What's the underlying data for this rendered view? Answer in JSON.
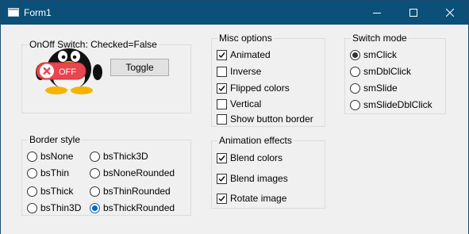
{
  "window": {
    "title": "Form1"
  },
  "onoff": {
    "caption": "OnOff Switch: Checked=False",
    "switch_text": "OFF",
    "toggle_label": "Toggle"
  },
  "border_style": {
    "caption": "Border style",
    "options": [
      "bsNone",
      "bsThin",
      "bsThick",
      "bsThin3D",
      "bsThick3D",
      "bsNoneRounded",
      "bsThinRounded",
      "bsThickRounded"
    ],
    "selected": "bsThickRounded"
  },
  "misc": {
    "caption": "Misc options",
    "items": [
      {
        "label": "Animated",
        "checked": true
      },
      {
        "label": "Inverse",
        "checked": false
      },
      {
        "label": "Flipped colors",
        "checked": true
      },
      {
        "label": "Vertical",
        "checked": false
      },
      {
        "label": "Show button border",
        "checked": false
      }
    ]
  },
  "animation": {
    "caption": "Animation effects",
    "items": [
      {
        "label": "Blend colors",
        "checked": true
      },
      {
        "label": "Blend images",
        "checked": true
      },
      {
        "label": "Rotate image",
        "checked": true
      }
    ]
  },
  "switch_mode": {
    "caption": "Switch mode",
    "options": [
      "smClick",
      "smDblClick",
      "smSlide",
      "smSlideDblClick"
    ],
    "selected": "smClick"
  },
  "colors": {
    "titlebar": "#0b5078",
    "client": "#f0f0f0",
    "switch_red": "#e8454f",
    "radio_blue": "#0a64c8"
  }
}
